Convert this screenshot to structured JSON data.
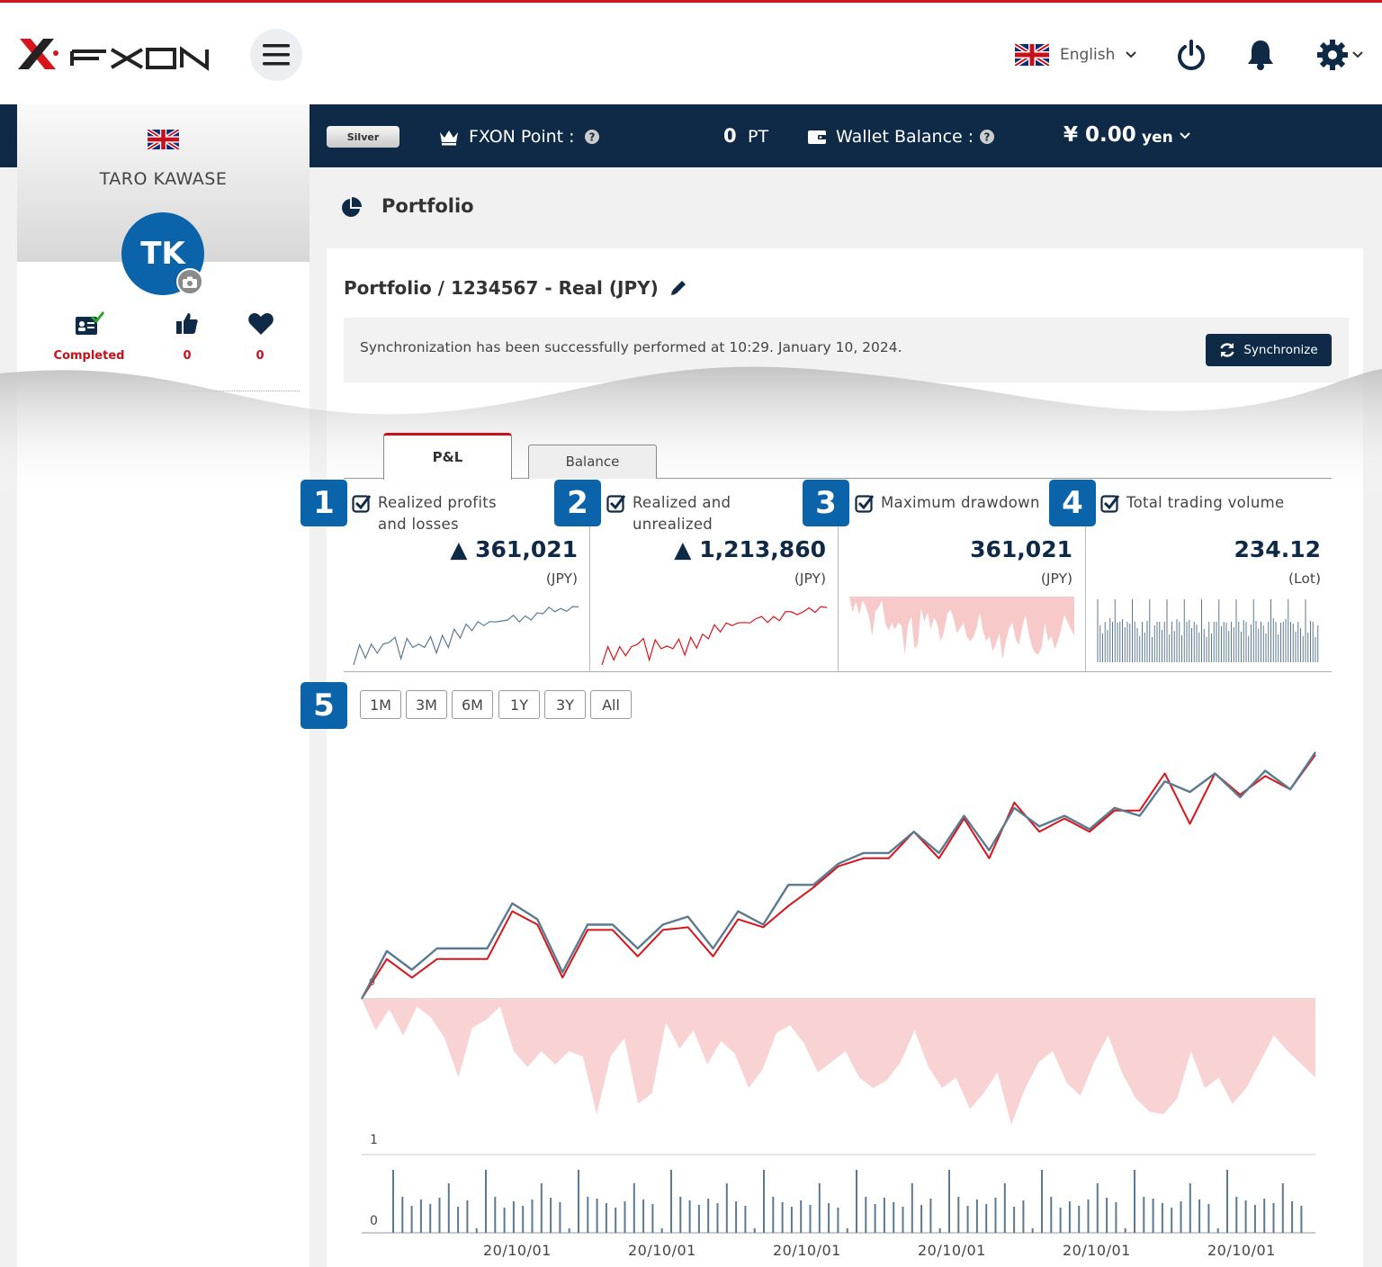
{
  "header": {
    "logo_text": "FXON",
    "language": "English",
    "menu_icon": "hamburger-icon",
    "power_icon": "power-icon",
    "bell_icon": "bell-icon",
    "settings_icon": "gear-icon"
  },
  "infobar": {
    "rank": "Silver",
    "point_label": "FXON Point :",
    "point_value": "0",
    "point_unit": "PT",
    "wallet_label": "Wallet Balance :",
    "wallet_value": "¥ 0.00",
    "wallet_unit": "yen"
  },
  "sidebar": {
    "user_name": "TARO KAWASE",
    "initials": "TK",
    "stats": [
      {
        "icon": "id-card-check-icon",
        "label": "Completed"
      },
      {
        "icon": "thumbs-up-icon",
        "label": "0"
      },
      {
        "icon": "heart-icon",
        "label": "0"
      }
    ]
  },
  "page": {
    "title": "Portfolio",
    "card_title": "Portfolio / 1234567 - Real (JPY)",
    "sync_message": "Synchronization has been successfully performed at 10:29. January 10, 2024.",
    "sync_button": "Synchronize"
  },
  "tabs": [
    {
      "label": "P&L",
      "active": true
    },
    {
      "label": "Balance",
      "active": false
    }
  ],
  "metrics": [
    {
      "badge": "1",
      "label_line1": "Realized profits",
      "label_line2": "and losses",
      "value": "▲ 361,021",
      "unit": "(JPY)",
      "checked": true,
      "spark_color": "#5b7a92"
    },
    {
      "badge": "2",
      "label_line1": "Realized and",
      "label_line2": "unrealized",
      "value": "▲ 1,213,860",
      "unit": "(JPY)",
      "checked": true,
      "spark_color": "#d8141b"
    },
    {
      "badge": "3",
      "label_line1": "Maximum drawdown",
      "label_line2": "",
      "value": "361,021",
      "unit": "(JPY)",
      "checked": true,
      "spark_color": "#f7c9c9"
    },
    {
      "badge": "4",
      "label_line1": "Total trading volume",
      "label_line2": "",
      "value": "234.12",
      "unit": "(Lot)",
      "checked": true,
      "spark_color": "#5b7a92"
    }
  ],
  "range_badge": "5",
  "ranges": [
    "1M",
    "3M",
    "6M",
    "1Y",
    "3Y",
    "All"
  ],
  "chart_data": {
    "type": "line",
    "series": [
      {
        "values": [
          0,
          18,
          11,
          19,
          19,
          19,
          36,
          30,
          10,
          28,
          28,
          19,
          28,
          31,
          19,
          33,
          28,
          43,
          43,
          51,
          55,
          55,
          63,
          55,
          69,
          56,
          72,
          65,
          69,
          64,
          72,
          69,
          82,
          78,
          85,
          76,
          86,
          79,
          93
        ],
        "color": "#5b7a92"
      },
      {
        "values": [
          0,
          15,
          8,
          15,
          15,
          15,
          33,
          28,
          8,
          26,
          26,
          16,
          26,
          27,
          16,
          30,
          27,
          35,
          42,
          50,
          53,
          53,
          63,
          53,
          68,
          53,
          74,
          63,
          68,
          63,
          71,
          71,
          85,
          66,
          85,
          77,
          84,
          79,
          92
        ],
        "color": "#d8141b"
      }
    ],
    "drawdown": [
      0,
      12,
      4,
      14,
      3,
      7,
      15,
      30,
      11,
      8,
      3,
      20,
      26,
      20,
      25,
      20,
      22,
      44,
      22,
      15,
      40,
      36,
      9,
      19,
      12,
      25,
      16,
      21,
      34,
      27,
      13,
      10,
      17,
      28,
      24,
      20,
      30,
      34,
      31,
      24,
      12,
      26,
      34,
      30,
      42,
      36,
      28,
      48,
      34,
      24,
      20,
      32,
      37,
      24,
      14,
      28,
      38,
      43,
      44,
      38,
      20,
      34,
      30,
      40,
      34,
      24,
      14,
      20,
      25,
      30
    ],
    "volume_ticks": [
      "1",
      "0"
    ],
    "x_ticks": [
      "20/10/01",
      "20/10/01",
      "20/10/01",
      "20/10/01",
      "20/10/01",
      "20/10/01"
    ],
    "start_marker": "0"
  },
  "colors": {
    "accent": "#d8141b",
    "navy": "#0e2a47",
    "badge_blue": "#0b63aa",
    "drawdown_fill": "#f9d3d3"
  }
}
